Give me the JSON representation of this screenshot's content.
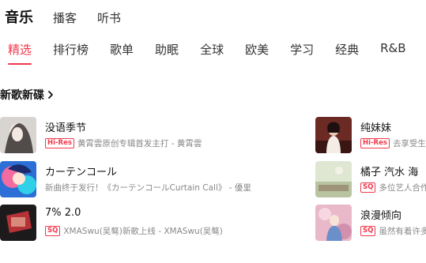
{
  "top_tabs": [
    {
      "label": "音乐",
      "active": true
    },
    {
      "label": "播客",
      "active": false
    },
    {
      "label": "听书",
      "active": false
    }
  ],
  "sub_tabs": [
    {
      "label": "精选",
      "active": true
    },
    {
      "label": "排行榜"
    },
    {
      "label": "歌单"
    },
    {
      "label": "助眠"
    },
    {
      "label": "全球"
    },
    {
      "label": "欧美"
    },
    {
      "label": "学习"
    },
    {
      "label": "经典"
    },
    {
      "label": "R&B"
    }
  ],
  "section": {
    "title": "新歌新碟",
    "icon": "chevron-right-icon"
  },
  "left_items": [
    {
      "title": "没语季节",
      "tag": "Hi-Res",
      "subtitle": "黄霄雲原创专辑首发主打 - 黄霄雲"
    },
    {
      "title": "カーテンコール",
      "tag": "",
      "subtitle": "新曲终于发行！《カーテンコールCurtain Call》 - 優里"
    },
    {
      "title": "7% 2.0",
      "tag": "SQ",
      "subtitle": "XMASwu(吴骜)新歌上线 - XMASwu(吴骜)"
    }
  ],
  "right_items": [
    {
      "title": "纯妹妹",
      "tag": "Hi-Res",
      "subtitle": "去享受生活"
    },
    {
      "title": "橘子 汽水 海",
      "tag": "SQ",
      "subtitle": "多位艺人合作"
    },
    {
      "title": "浪漫倾向",
      "tag": "SQ",
      "subtitle": "虽然有着许多"
    }
  ],
  "colors": {
    "accent": "#f0384b",
    "text": "#111111",
    "secondary": "#888888"
  }
}
